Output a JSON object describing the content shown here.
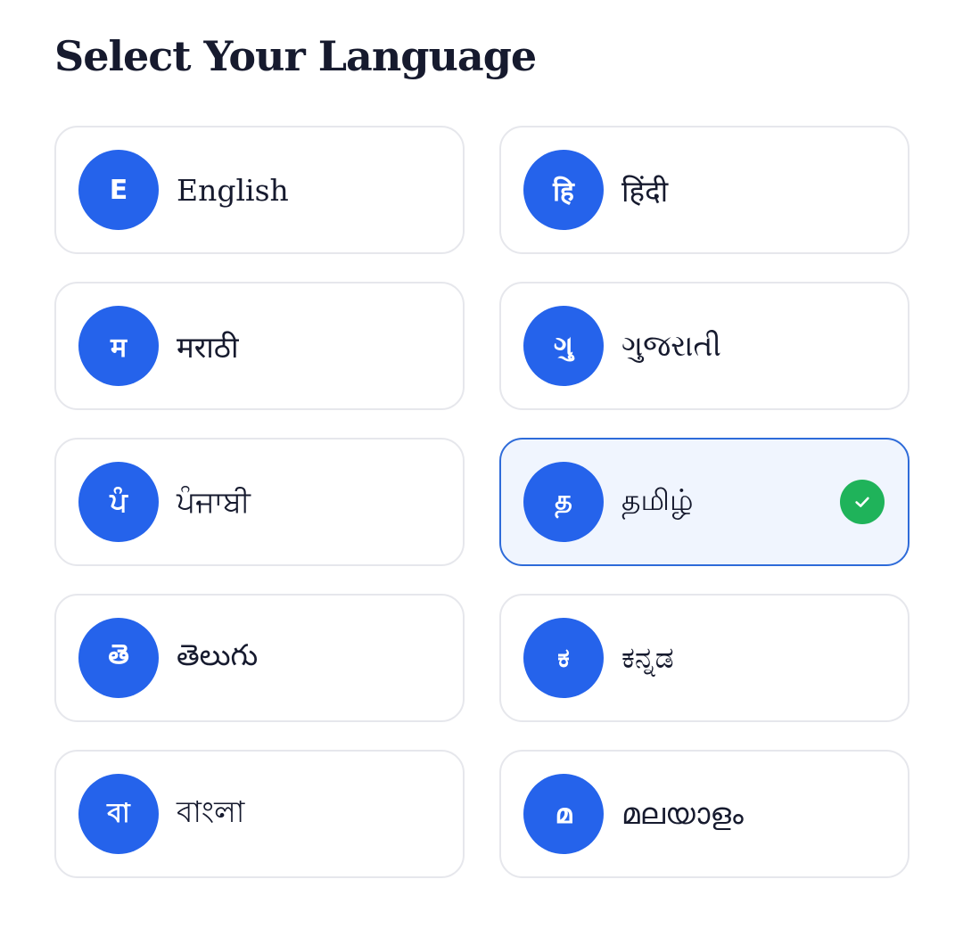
{
  "page": {
    "title": "Select Your Language"
  },
  "languages": [
    {
      "badge": "E",
      "name": "English",
      "selected": false
    },
    {
      "badge": "हि",
      "name": "हिंदी",
      "selected": false
    },
    {
      "badge": "म",
      "name": "मराठी",
      "selected": false
    },
    {
      "badge": "ગુ",
      "name": "ગુજરાતી",
      "selected": false
    },
    {
      "badge": "ਪੰ",
      "name": "ਪੰਜਾਬੀ",
      "selected": false
    },
    {
      "badge": "த",
      "name": "தமிழ்",
      "selected": true
    },
    {
      "badge": "తె",
      "name": "తెలుగు",
      "selected": false
    },
    {
      "badge": "ಕ",
      "name": "ಕನ್ನಡ",
      "selected": false
    },
    {
      "badge": "বা",
      "name": "বাংলা",
      "selected": false
    },
    {
      "badge": "മ",
      "name": "മലയാളം",
      "selected": false
    }
  ],
  "icons": {
    "selected_indicator": "check-circle-icon"
  },
  "colors": {
    "accent": "#2563eb",
    "selected_border": "#2e6bd9",
    "selected_background": "#f0f5fe",
    "check": "#1fb35a",
    "card_border": "#e6e7ec",
    "title": "#161a2e"
  }
}
